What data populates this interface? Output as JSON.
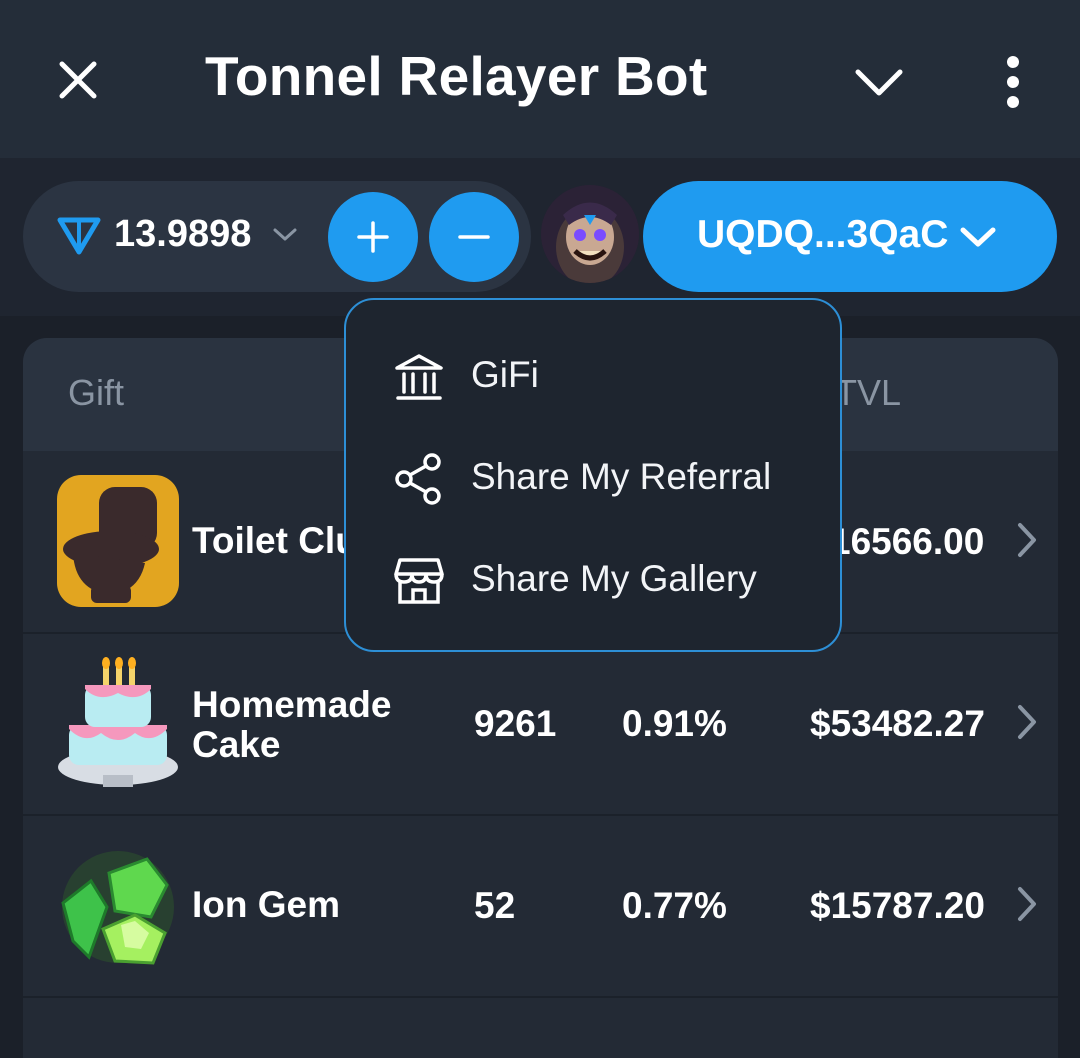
{
  "header": {
    "title": "Tonnel Relayer Bot"
  },
  "toolbar": {
    "balance": "13.9898",
    "wallet": "UQDQ...3QaC"
  },
  "table": {
    "columns": {
      "gift": "Gift",
      "tvl": "TVL"
    },
    "rows": [
      {
        "name": "Toilet Clu",
        "tvl": "16566.00"
      },
      {
        "name": "Homemade Cake",
        "supply": "9261",
        "change": "0.91%",
        "tvl": "$53482.27"
      },
      {
        "name": "Ion Gem",
        "supply": "52",
        "change": "0.77%",
        "tvl": "$15787.20"
      }
    ]
  },
  "menu": {
    "items": [
      {
        "label": "GiFi",
        "icon": "bank-icon"
      },
      {
        "label": "Share My Referral",
        "icon": "share-icon"
      },
      {
        "label": "Share My Gallery",
        "icon": "store-icon"
      }
    ]
  },
  "colors": {
    "accent": "#1f9bf0",
    "background": "#1b2029",
    "header": "#242d39",
    "menu_border": "#2d8fd6"
  }
}
